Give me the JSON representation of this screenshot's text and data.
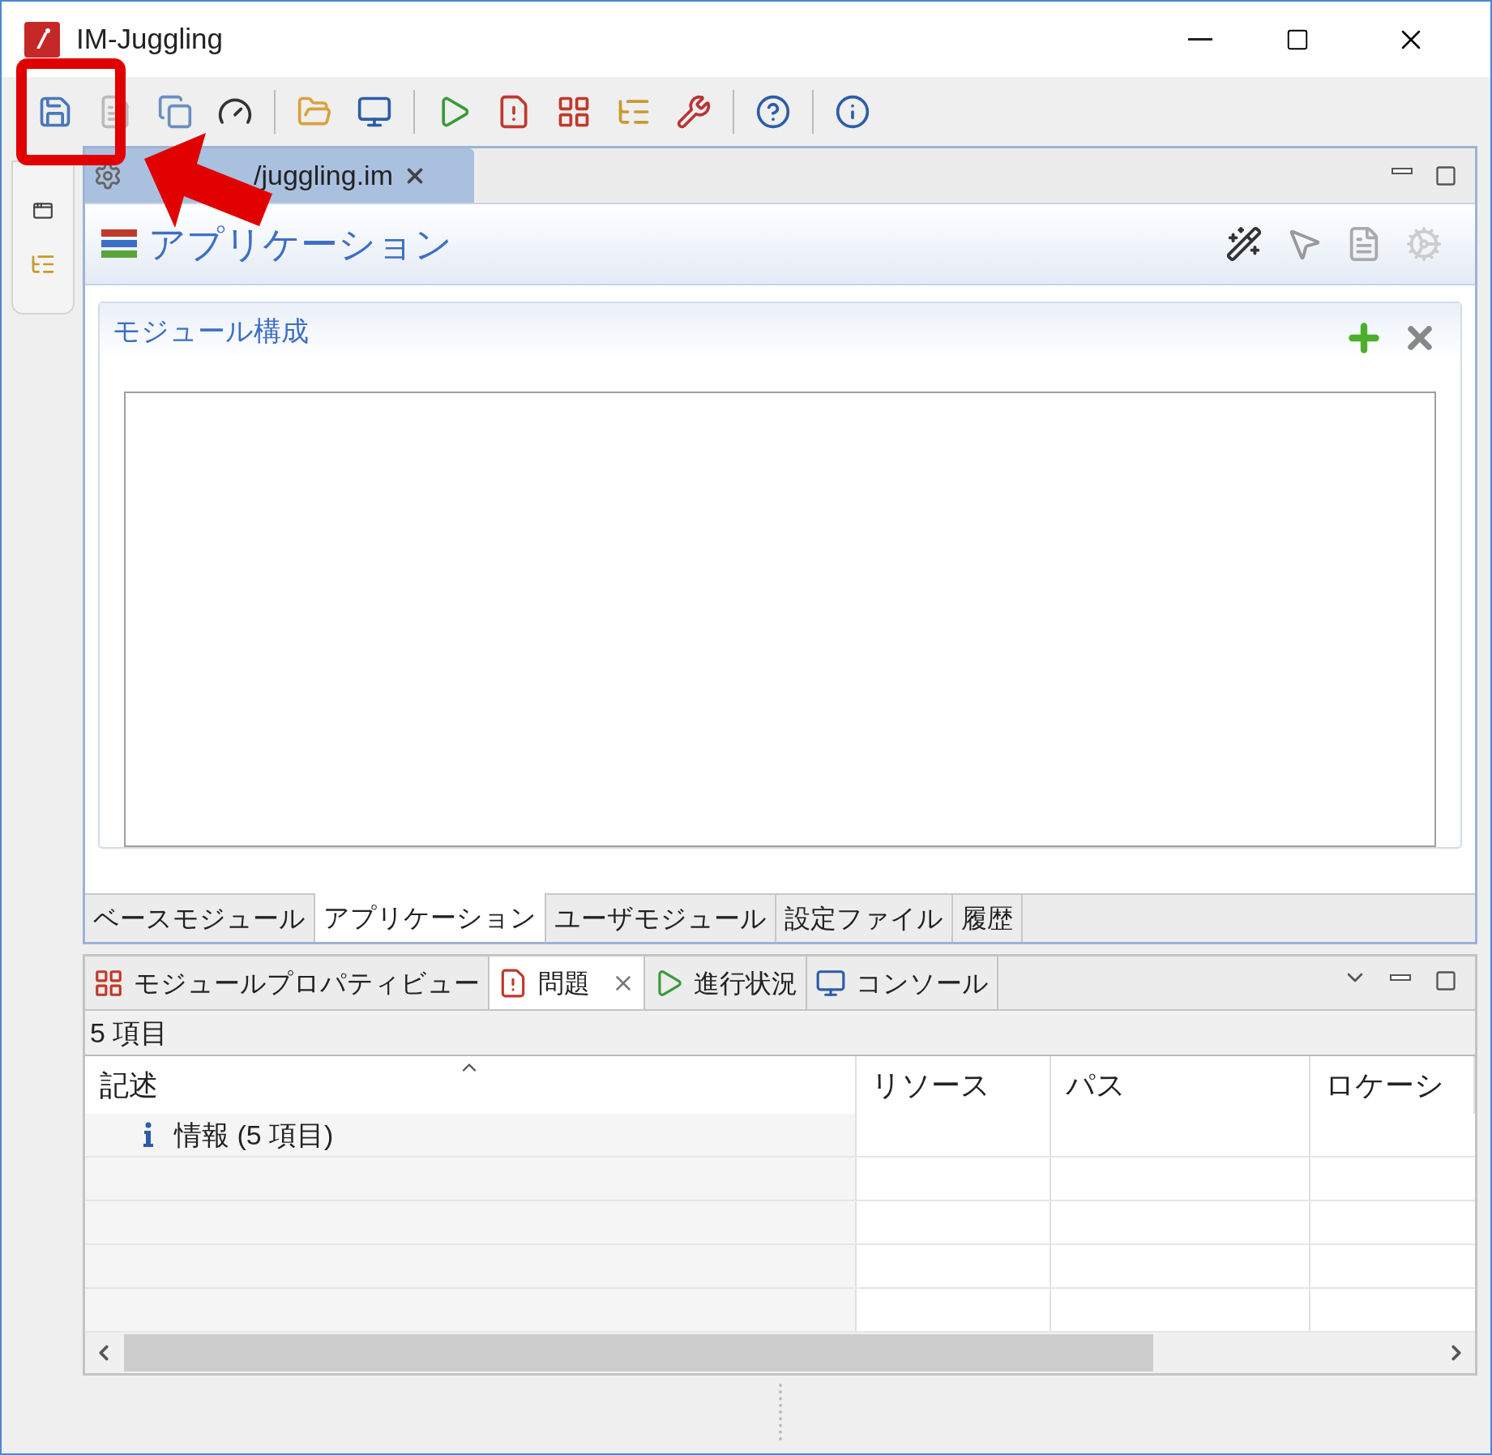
{
  "window": {
    "title": "IM-Juggling"
  },
  "editor_tab": {
    "title": "/juggling.im"
  },
  "editor": {
    "title": "アプリケーション",
    "section": {
      "title": "モジュール構成"
    }
  },
  "editor_tabs": [
    {
      "label": "ベースモジュール",
      "selected": false
    },
    {
      "label": "アプリケーション",
      "selected": true
    },
    {
      "label": "ユーザモジュール",
      "selected": false
    },
    {
      "label": "設定ファイル",
      "selected": false
    },
    {
      "label": "履歴",
      "selected": false
    }
  ],
  "panel_tabs": [
    {
      "label": "モジュールプロパティビュー",
      "selected": false,
      "kind": "module"
    },
    {
      "label": "問題",
      "selected": true,
      "kind": "problems"
    },
    {
      "label": "進行状況",
      "selected": false,
      "kind": "progress"
    },
    {
      "label": "コンソール",
      "selected": false,
      "kind": "console"
    }
  ],
  "problems": {
    "summary": "5 項目",
    "columns": [
      "記述",
      "リソース",
      "パス",
      "ロケーシ"
    ],
    "rows": [
      {
        "description": "情報 (5 項目)"
      }
    ]
  }
}
